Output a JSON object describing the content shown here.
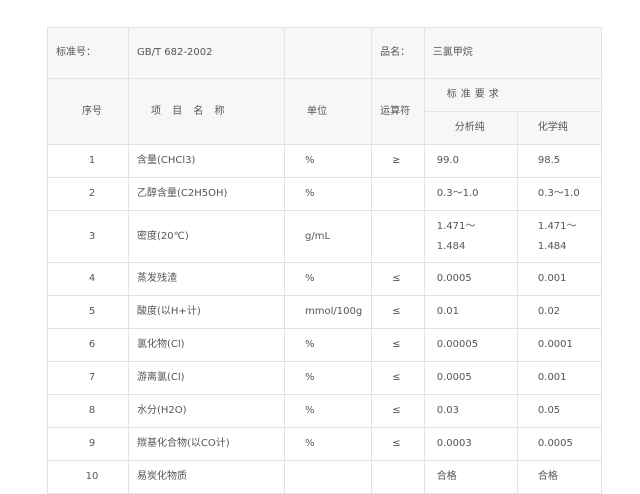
{
  "header": {
    "std_label": "标准号：",
    "std_value": "GB/T 682-2002",
    "product_label": "品名：",
    "product_value": "三氯甲烷"
  },
  "columns": {
    "no": "序号",
    "item": "项 目 名 称",
    "unit": "单位",
    "op": "运算符",
    "req": "标准要求",
    "grade_ar": "分析纯",
    "grade_cp": "化学纯"
  },
  "rows": [
    {
      "no": "1",
      "item": "含量(CHCl3)",
      "unit": "%",
      "op": "≥",
      "ar": "99.0",
      "cp": "98.5"
    },
    {
      "no": "2",
      "item": "乙醇含量(C2H5OH)",
      "unit": "%",
      "op": "",
      "ar": "0.3～1.0",
      "cp": "0.3～1.0"
    },
    {
      "no": "3",
      "item": "密度(20℃)",
      "unit": "g/mL",
      "op": "",
      "ar": "1.471～1.484",
      "cp": "1.471～1.484"
    },
    {
      "no": "4",
      "item": "蒸发残渣",
      "unit": "%",
      "op": "≤",
      "ar": "0.0005",
      "cp": "0.001"
    },
    {
      "no": "5",
      "item": "酸度(以H+计)",
      "unit": "mmol/100g",
      "op": "≤",
      "ar": "0.01",
      "cp": "0.02"
    },
    {
      "no": "6",
      "item": "氯化物(Cl)",
      "unit": "%",
      "op": "≤",
      "ar": "0.00005",
      "cp": "0.0001"
    },
    {
      "no": "7",
      "item": "游离氯(Cl)",
      "unit": "%",
      "op": "≤",
      "ar": "0.0005",
      "cp": "0.001"
    },
    {
      "no": "8",
      "item": "水分(H2O)",
      "unit": "%",
      "op": "≤",
      "ar": "0.03",
      "cp": "0.05"
    },
    {
      "no": "9",
      "item": "羰基化合物(以CO计)",
      "unit": "%",
      "op": "≤",
      "ar": "0.0003",
      "cp": "0.0005"
    },
    {
      "no": "10",
      "item": "易炭化物质",
      "unit": "",
      "op": "",
      "ar": "合格",
      "cp": "合格"
    }
  ]
}
